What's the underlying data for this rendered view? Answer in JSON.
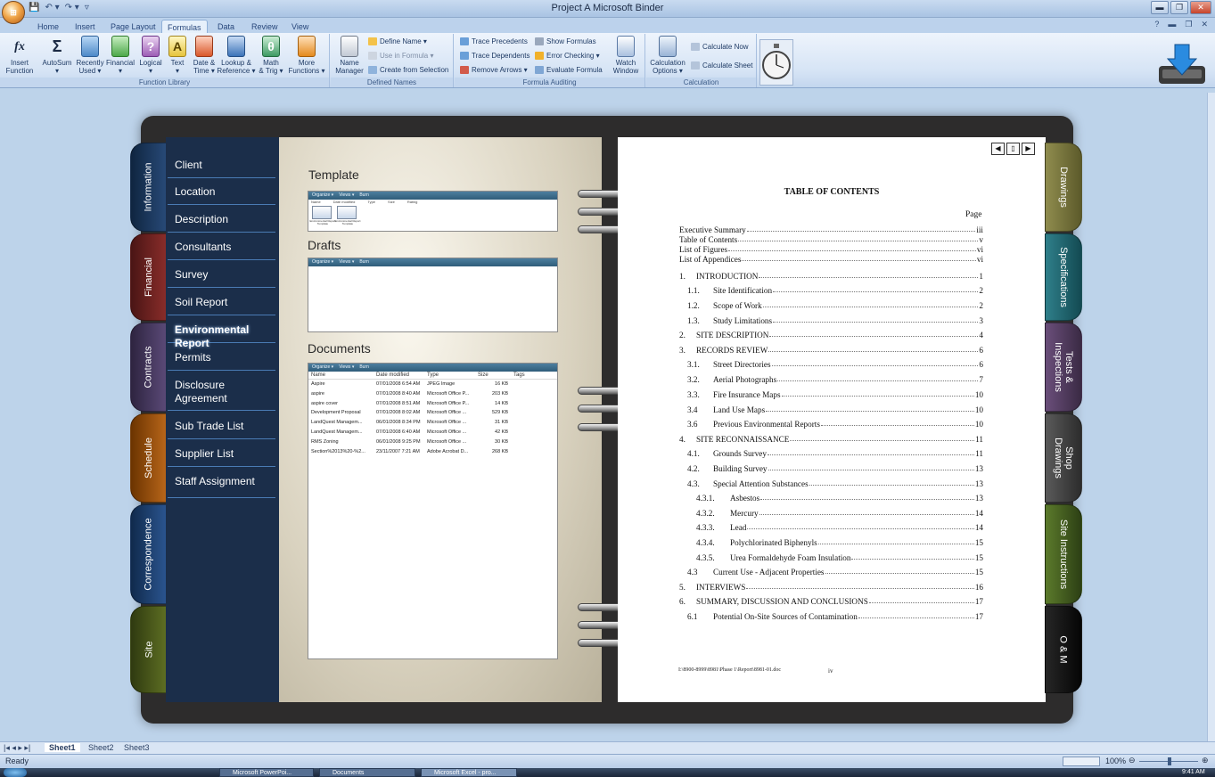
{
  "window": {
    "title": "Project A  Microsoft Binder",
    "orb_label": "⊞",
    "qat": [
      "💾",
      "↶ ▾",
      "↷ ▾",
      "▿"
    ],
    "controls": [
      "▬",
      "❐",
      "✕"
    ]
  },
  "ribbon_tabs": [
    "Home",
    "Insert",
    "Page Layout",
    "Formulas",
    "Data",
    "Review",
    "View"
  ],
  "active_tab": "Formulas",
  "help_controls": [
    "?",
    "▬",
    "❐",
    "✕"
  ],
  "ribbon": {
    "function_library": {
      "label": "Function Library",
      "buttons": [
        "Insert\nFunction",
        "AutoSum\n▾",
        "Recently\nUsed ▾",
        "Financial\n▾",
        "Logical\n▾",
        "Text\n▾",
        "Date &\nTime ▾",
        "Lookup &\nReference ▾",
        "Math\n& Trig ▾",
        "More\nFunctions ▾"
      ],
      "icons": [
        "fx",
        "Σ",
        "",
        "",
        "?",
        "A",
        "",
        "",
        "θ",
        ""
      ]
    },
    "defined_names": {
      "label": "Defined Names",
      "name_manager": "Name\nManager",
      "define_name": "Define Name ▾",
      "use_in_formula": "Use in Formula ▾",
      "create_from_selection": "Create from Selection"
    },
    "formula_auditing": {
      "label": "Formula Auditing",
      "trace_precedents": "Trace Precedents",
      "trace_dependents": "Trace Dependents",
      "remove_arrows": "Remove Arrows ▾",
      "show_formulas": "Show Formulas",
      "error_checking": "Error Checking ▾",
      "evaluate_formula": "Evaluate Formula",
      "watch_window": "Watch\nWindow"
    },
    "calculation": {
      "label": "Calculation",
      "options": "Calculation\nOptions ▾",
      "calculate_now": "Calculate Now",
      "calculate_sheet": "Calculate Sheet"
    }
  },
  "left_tabs": [
    "Information",
    "Financial",
    "Contracts",
    "Schedule",
    "Correspondence",
    "Site"
  ],
  "right_tabs": [
    "Drawings",
    "Specifications",
    "Tests &\nInspections",
    "Shop\nDrawings",
    "Site Instructions",
    "O & M"
  ],
  "nav_items": [
    "Client",
    "Location",
    "Description",
    "Consultants",
    "Survey",
    "Soil Report",
    "Environmental Report",
    "Permits",
    "Disclosure\nAgreement",
    "Sub Trade List",
    "Supplier List",
    "Staff  Assignment"
  ],
  "selected_nav": "Environmental Report",
  "left_page": {
    "sections": [
      "Template",
      "Drafts",
      "Documents"
    ],
    "toolbar": [
      "Organize ▾",
      "Views ▾",
      "Burn"
    ],
    "template_headers": [
      "Name",
      "Date modified",
      "Type",
      "Size",
      "Rating"
    ],
    "template_items": [
      "Environmental Report Template",
      "Environmental Report Template"
    ],
    "columns": [
      "Name",
      "Date modified",
      "Type",
      "Size",
      "Tags"
    ],
    "files": [
      [
        "Aspire",
        "07/01/2008 6:54 AM",
        "JPEG Image",
        "16 KB"
      ],
      [
        "aspire",
        "07/01/2008 8:40 AM",
        "Microsoft Office P...",
        "203 KB"
      ],
      [
        "aspire cover",
        "07/01/2008 8:51 AM",
        "Microsoft Office P...",
        "14 KB"
      ],
      [
        "Development Proposal",
        "07/01/2008 8:02 AM",
        "Microsoft Office ...",
        "529 KB"
      ],
      [
        "LandQuest Managem...",
        "06/01/2008 8:34 PM",
        "Microsoft Office ...",
        "31 KB"
      ],
      [
        "LandQuest Managem...",
        "07/01/2008 6:40 AM",
        "Microsoft Office ...",
        "42 KB"
      ],
      [
        "RMS Zoning",
        "06/01/2008 9:25 PM",
        "Microsoft Office ...",
        "30 KB"
      ],
      [
        "Section%2013%20-%2...",
        "23/11/2007 7:21 AM",
        "Adobe Acrobat D...",
        "268 KB"
      ]
    ]
  },
  "page_nav": [
    "◀",
    "▯",
    "▶"
  ],
  "toc": {
    "title": "TABLE OF CONTENTS",
    "page_heading": "Page",
    "entries": [
      {
        "num": "",
        "text": "Executive Summary",
        "page": "iii"
      },
      {
        "num": "",
        "text": "Table of Contents",
        "page": "v"
      },
      {
        "num": "",
        "text": "List of Figures",
        "page": "vi"
      },
      {
        "num": "",
        "text": "List of Appendices",
        "page": "vi"
      },
      {
        "num": "1.",
        "text": "INTRODUCTION",
        "page": "1"
      },
      {
        "num": "1.1.",
        "text": "Site Identification",
        "page": "2"
      },
      {
        "num": "1.2.",
        "text": "Scope of Work",
        "page": "2"
      },
      {
        "num": "1.3.",
        "text": "Study Limitations",
        "page": "3"
      },
      {
        "num": "2.",
        "text": "SITE DESCRIPTION",
        "page": "4"
      },
      {
        "num": "3.",
        "text": "RECORDS REVIEW",
        "page": "6"
      },
      {
        "num": "3.1.",
        "text": "Street Directories",
        "page": "6"
      },
      {
        "num": "3.2.",
        "text": "Aerial Photographs",
        "page": "7"
      },
      {
        "num": "3.3.",
        "text": "Fire Insurance Maps",
        "page": "10"
      },
      {
        "num": "3.4",
        "text": "Land Use Maps",
        "page": "10"
      },
      {
        "num": "3.6",
        "text": "Previous Environmental Reports",
        "page": "10"
      },
      {
        "num": "4.",
        "text": "SITE RECONNAISSANCE",
        "page": "11"
      },
      {
        "num": "4.1.",
        "text": "Grounds Survey",
        "page": "11"
      },
      {
        "num": "4.2.",
        "text": "Building Survey",
        "page": "13"
      },
      {
        "num": "4.3.",
        "text": "Special Attention Substances",
        "page": "13"
      },
      {
        "num": "4.3.1.",
        "text": "Asbestos",
        "page": "13"
      },
      {
        "num": "4.3.2.",
        "text": "Mercury",
        "page": "14"
      },
      {
        "num": "4.3.3.",
        "text": "Lead",
        "page": "14"
      },
      {
        "num": "4.3.4.",
        "text": "Polychlorinated Biphenyls",
        "page": "15"
      },
      {
        "num": "4.3.5.",
        "text": "Urea Formaldehyde Foam Insulation",
        "page": "15"
      },
      {
        "num": "4.3",
        "text": "Current Use - Adjacent Properties",
        "page": "15"
      },
      {
        "num": "5.",
        "text": "INTERVIEWS",
        "page": "16"
      },
      {
        "num": "6.",
        "text": "SUMMARY, DISCUSSION AND CONCLUSIONS",
        "page": "17"
      },
      {
        "num": "6.1",
        "text": "Potential On-Site Sources of Contamination",
        "page": "17"
      }
    ],
    "footer_path": "I:\\8900-8999\\8981\\Phase 1\\Report\\8981-01.doc",
    "footer_page": "iv"
  },
  "sheet_nav": "|◂ ◂ ▸ ▸|",
  "sheets": [
    "Sheet1",
    "Sheet2",
    "Sheet3"
  ],
  "status": {
    "ready": "Ready",
    "zoom": "100%",
    "zoom_controls": [
      "⊖",
      "⊕"
    ]
  },
  "taskbar": [
    "Microsoft PowerPoi...",
    "Documents",
    "Microsoft Excel - pro..."
  ],
  "clock": "9:41 AM",
  "colors": {
    "nav_bg": "#1b2e4a",
    "accent": "#4a7bb4"
  }
}
